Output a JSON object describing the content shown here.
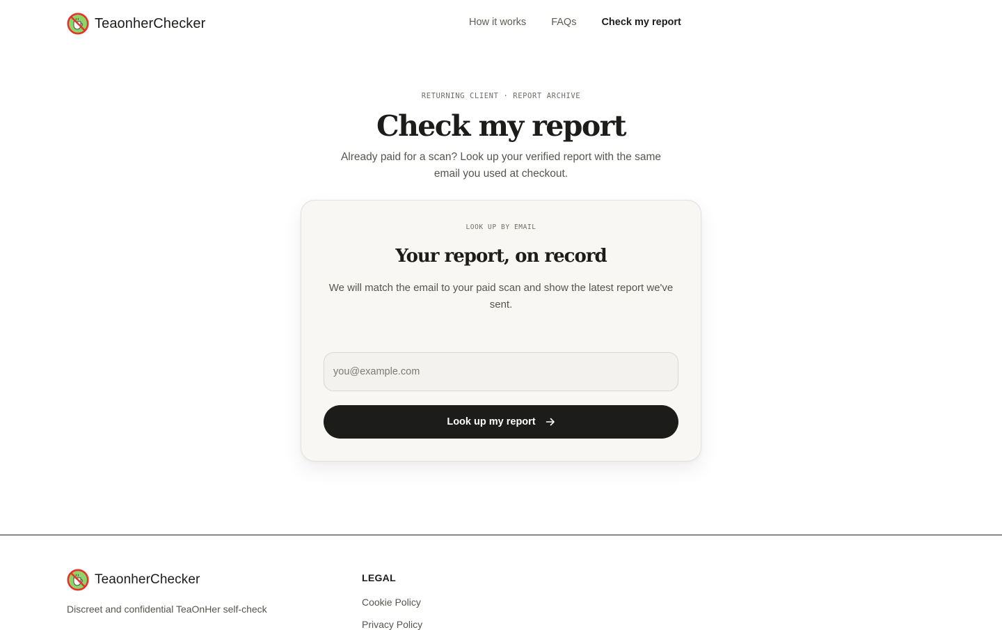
{
  "brand": {
    "name": "TeaonherChecker",
    "logo_icon": "no-tea-cup-icon"
  },
  "nav": {
    "items": [
      {
        "label": "How it works",
        "active": false
      },
      {
        "label": "FAQs",
        "active": false
      },
      {
        "label": "Check my report",
        "active": true
      }
    ]
  },
  "hero": {
    "eyebrow": "RETURNING CLIENT · REPORT ARCHIVE",
    "title": "Check my report",
    "subtitle": "Already paid for a scan? Look up your verified report with the same email you used at checkout."
  },
  "card": {
    "eyebrow": "LOOK UP BY EMAIL",
    "title": "Your report, on record",
    "text": "We will match the email to your paid scan and show the latest report we've sent.",
    "email_value": "",
    "email_placeholder": "you@example.com",
    "button_label": "Look up my report",
    "button_icon": "arrow-right-icon"
  },
  "footer": {
    "brand_name": "TeaonherChecker",
    "tagline": "Discreet and confidential TeaOnHer self-check",
    "legal_heading": "LEGAL",
    "legal_links": [
      "Cookie Policy",
      "Privacy Policy"
    ]
  },
  "colors": {
    "ink": "#1c1c1a",
    "muted": "#55554f",
    "card_bg": "#f8f7f3",
    "logo_ring": "#e5332a",
    "logo_fill": "#8fd46a"
  }
}
